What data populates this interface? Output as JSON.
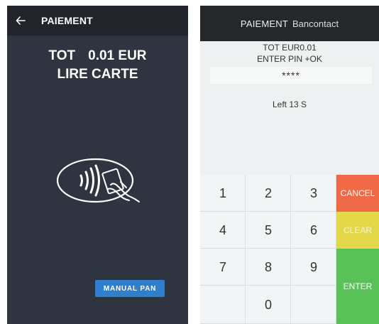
{
  "left_screen": {
    "header_title": "PAIEMENT",
    "amount_label": "TOT",
    "amount_value": "0.01 EUR",
    "instruction": "LIRE CARTE",
    "manual_button": "MANUAL PAN",
    "icons": {
      "back": "back-arrow-icon",
      "contactless": "contactless-card-icon"
    },
    "colors": {
      "background": "#2e3440",
      "header": "#21252b",
      "button": "#2f7fcf"
    }
  },
  "right_screen": {
    "header_title": "PAIEMENT",
    "header_subtitle": "Bancontact",
    "line1": "TOT  EUR0.01",
    "line2": "ENTER PIN  +OK",
    "pin_mask": "****",
    "timer": "Left 13 S",
    "keys": {
      "k1": "1",
      "k2": "2",
      "k3": "3",
      "k4": "4",
      "k5": "5",
      "k6": "6",
      "k7": "7",
      "k8": "8",
      "k9": "9",
      "k0": "0",
      "cancel": "CANCEL",
      "clear": "CLEAR",
      "enter": "ENTER"
    },
    "colors": {
      "cancel": "#f06a47",
      "clear": "#e3d84a",
      "enter": "#58c158",
      "header": "#25282b"
    }
  }
}
